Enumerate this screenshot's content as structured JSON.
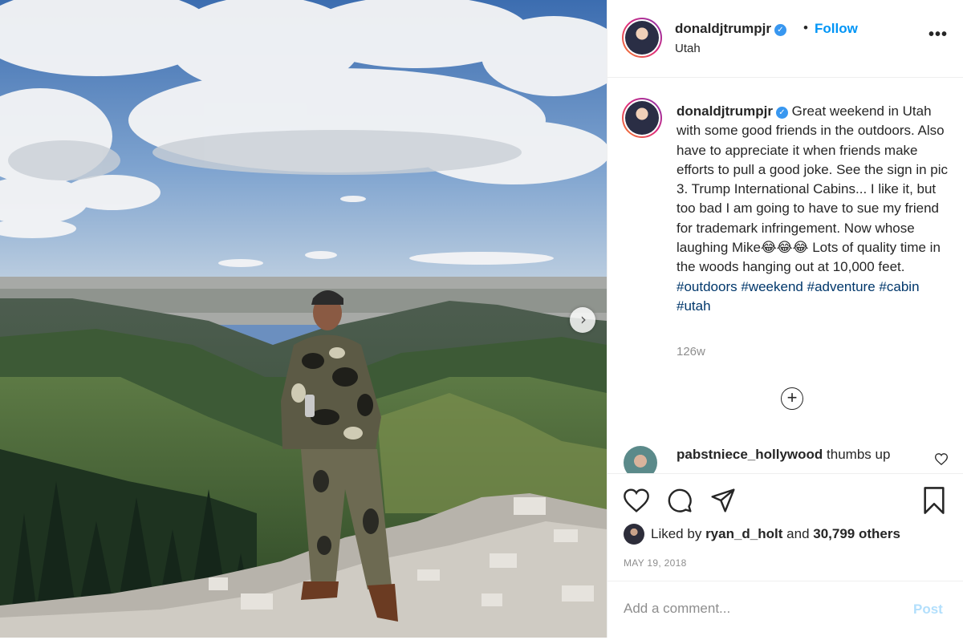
{
  "header": {
    "username": "donaldjtrumpjr",
    "separator": "•",
    "follow_label": "Follow",
    "location": "Utah",
    "more_label": "•••"
  },
  "caption": {
    "username": "donaldjtrumpjr",
    "text": " Great weekend in Utah with some good friends in the outdoors. Also have to appreciate it when friends make efforts to pull a good joke. See the sign in pic 3. Trump International Cabins... I like it, but too bad I am going to have to sue my friend for trademark infringement. Now whose laughing Mike😂😂😂 Lots of quality time in the woods hanging out at 10,000 feet. ",
    "hashtags": [
      "#outdoors",
      "#weekend",
      "#adventure",
      "#cabin",
      "#utah"
    ],
    "age": "126w"
  },
  "comment": {
    "username": "pabstniece_hollywood",
    "text": "thumbs up"
  },
  "likes": {
    "prefix": "Liked by ",
    "user": "ryan_d_holt",
    "middle": " and ",
    "others": "30,799 others"
  },
  "date": "MAY 19, 2018",
  "add_comment": {
    "placeholder": "Add a comment...",
    "post_label": "Post"
  },
  "icons": {
    "next": "chevron-right-icon",
    "verified": "verified-badge-icon",
    "like": "heart-icon",
    "comment": "speech-bubble-icon",
    "share": "paper-plane-icon",
    "save": "bookmark-icon",
    "load_more": "plus-circle-icon"
  },
  "colors": {
    "link": "#0095f6",
    "hashtag": "#00376b",
    "muted": "#8e8e8e",
    "verified": "#3897f0"
  }
}
